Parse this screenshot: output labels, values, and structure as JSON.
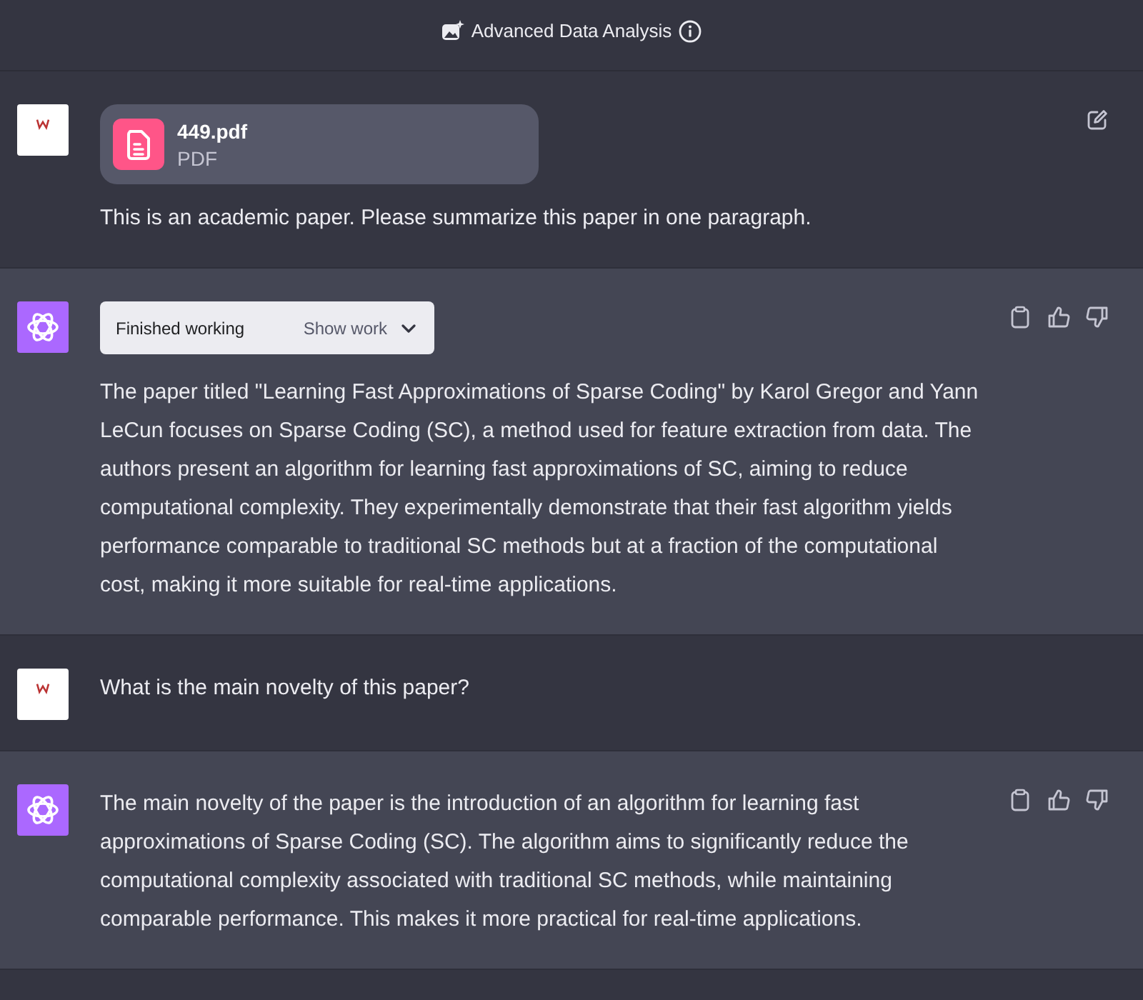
{
  "header": {
    "title": "Advanced Data Analysis"
  },
  "messages": [
    {
      "kind": "user",
      "hovered": true,
      "attachment": {
        "name": "449.pdf",
        "type": "PDF"
      },
      "text": "This is an academic paper. Please summarize this paper in one paragraph."
    },
    {
      "kind": "assistant",
      "status": {
        "label": "Finished working",
        "action": "Show work"
      },
      "text": "The paper titled \"Learning Fast Approximations of Sparse Coding\" by Karol Gregor and Yann LeCun focuses on Sparse Coding (SC), a method used for feature extraction from data. The authors present an algorithm for learning fast approximations of SC, aiming to reduce computational complexity. They experimentally demonstrate that their fast algorithm yields performance comparable to traditional SC methods but at a fraction of the computational cost, making it more suitable for real-time applications."
    },
    {
      "kind": "user",
      "hovered": false,
      "text": "What is the main novelty of this paper?"
    },
    {
      "kind": "assistant",
      "text": "The main novelty of the paper is the introduction of an algorithm for learning fast approximations of Sparse Coding (SC). The algorithm aims to significantly reduce the computational complexity associated with traditional SC methods, while maintaining comparable performance. This makes it more practical for real-time applications."
    }
  ]
}
